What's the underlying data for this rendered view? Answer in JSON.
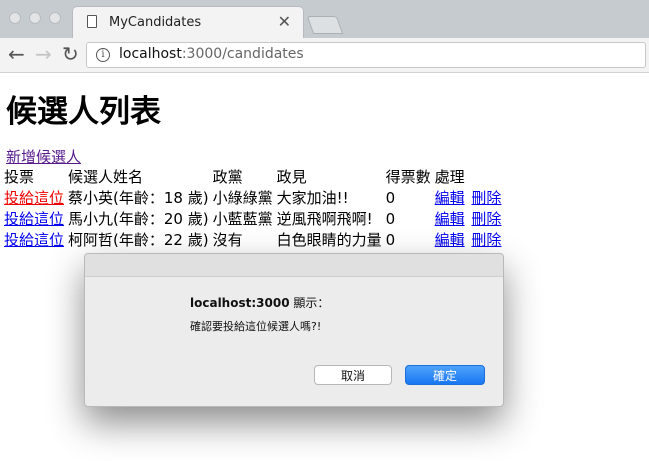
{
  "browser": {
    "tab_title": "MyCandidates",
    "tab_close": "✕",
    "url_host": "localhost",
    "url_rest": ":3000/candidates",
    "back_icon": "←",
    "forward_icon": "→",
    "reload_icon": "↻",
    "info_icon": "i"
  },
  "page": {
    "heading": "候選人列表",
    "add_link": "新增候選人",
    "table": {
      "headers": [
        "投票",
        "候選人姓名",
        "政黨",
        "政見",
        "得票數",
        "處理"
      ],
      "rows": [
        {
          "vote": "投給這位",
          "name": "蔡小英(年齡：18 歲)",
          "party": "小綠綠黨",
          "platform": "大家加油!!",
          "votes": "0",
          "edit": "編輯",
          "delete": "刪除"
        },
        {
          "vote": "投給這位",
          "name": "馬小九(年齡：20 歲)",
          "party": "小藍藍黨",
          "platform": "逆風飛啊飛啊!",
          "votes": "0",
          "edit": "編輯",
          "delete": "刪除"
        },
        {
          "vote": "投給這位",
          "name": "柯阿哲(年齡：22 歲)",
          "party": "沒有",
          "platform": "白色眼睛的力量",
          "votes": "0",
          "edit": "編輯",
          "delete": "刪除"
        }
      ]
    }
  },
  "dialog": {
    "title_host": "localhost:3000",
    "title_suffix": " 顯示：",
    "message": "確認要投給這位候選人嗎?!",
    "cancel_label": "取消",
    "ok_label": "確定"
  },
  "colors": {
    "link": "#0000ee",
    "visited_link": "#551a8b",
    "active_link": "#ee0000",
    "ok_button": "#1877f2"
  }
}
